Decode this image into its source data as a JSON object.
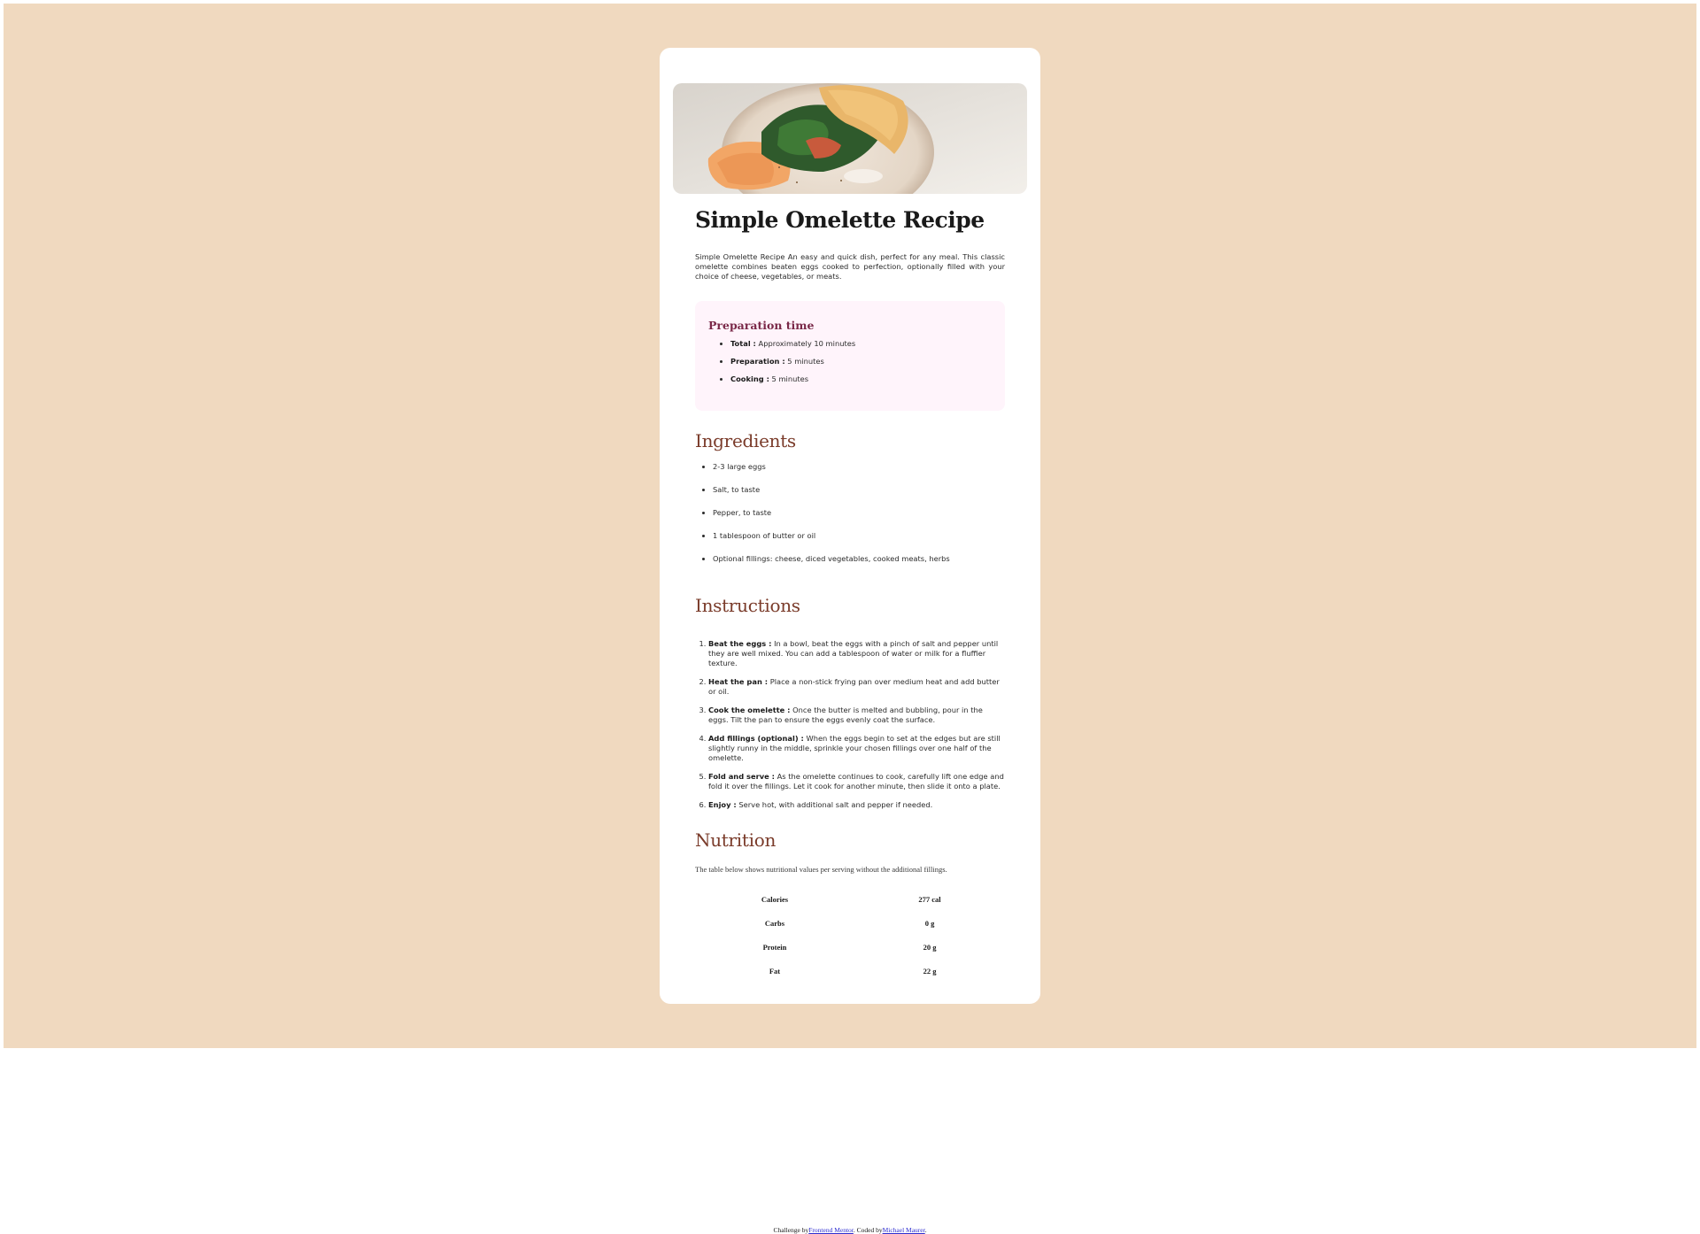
{
  "recipe": {
    "title": "Simple Omelette Recipe",
    "intro": "Simple Omelette Recipe An easy and quick dish, perfect for any meal. This classic omelette combines beaten eggs cooked to perfection, optionally filled with your choice of cheese, vegetables, or meats.",
    "prep": {
      "title": "Preparation time",
      "items": [
        {
          "label": "Total :",
          "value": "Approximately 10 minutes"
        },
        {
          "label": "Preparation :",
          "value": "5 minutes"
        },
        {
          "label": "Cooking :",
          "value": "5 minutes"
        }
      ]
    },
    "ingredients": {
      "title": "Ingredients",
      "items": [
        "2-3 large eggs",
        "Salt, to taste",
        "Pepper, to taste",
        "1 tablespoon of butter or oil",
        "Optional fillings: cheese, diced vegetables, cooked meats, herbs"
      ]
    },
    "instructions": {
      "title": "Instructions",
      "steps": [
        {
          "label": "Beat the eggs :",
          "text": "In a bowl, beat the eggs with a pinch of salt and pepper until they are well mixed. You can add a tablespoon of water or milk for a fluffier texture."
        },
        {
          "label": "Heat the pan :",
          "text": "Place a non-stick frying pan over medium heat and add butter or oil."
        },
        {
          "label": "Cook the omelette :",
          "text": "Once the butter is melted and bubbling, pour in the eggs. Tilt the pan to ensure the eggs evenly coat the surface."
        },
        {
          "label": "Add fillings (optional) :",
          "text": "When the eggs begin to set at the edges but are still slightly runny in the middle, sprinkle your chosen fillings over one half of the omelette."
        },
        {
          "label": "Fold and serve :",
          "text": "As the omelette continues to cook, carefully lift one edge and fold it over the fillings. Let it cook for another minute, then slide it onto a plate."
        },
        {
          "label": "Enjoy :",
          "text": "Serve hot, with additional salt and pepper if needed."
        }
      ]
    },
    "nutrition": {
      "title": "Nutrition",
      "description": "The table below shows nutritional values per serving without the additional fillings.",
      "rows": [
        {
          "label": "Calories",
          "value": "277 cal"
        },
        {
          "label": "Carbs",
          "value": "0 g"
        },
        {
          "label": "Protein",
          "value": "20 g"
        },
        {
          "label": "Fat",
          "value": "22 g"
        }
      ]
    }
  },
  "footer": {
    "prefix": "Challenge by",
    "link1": "Frontend Mentor",
    "middle": ". Coded by",
    "link2": "Michael Maurer",
    "suffix": "."
  },
  "colors": {
    "page_bg": "#f0d9bf",
    "card_bg": "#ffffff",
    "prep_bg": "#fff4fb",
    "prep_title": "#7a2848",
    "section_title": "#7a3b2a"
  },
  "images": {
    "hero": "omelette-plate-photo"
  }
}
